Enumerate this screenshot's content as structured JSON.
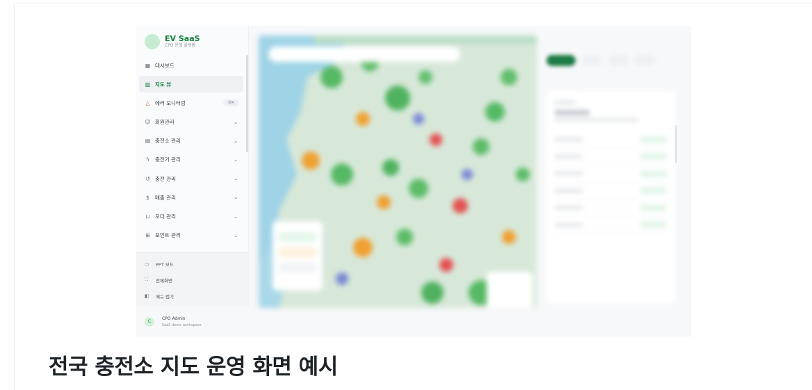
{
  "sidebar": {
    "brand_title": "EV SaaS",
    "brand_subtitle": "CPO 운영 플랫폼",
    "items": [
      {
        "label": "대시보드",
        "icon": "grid-icon"
      },
      {
        "label": "지도 뷰",
        "icon": "map-icon",
        "active": true
      },
      {
        "label": "에러 모니터링",
        "icon": "warning-icon",
        "badge": "알림"
      },
      {
        "label": "회원관리",
        "icon": "users-icon"
      },
      {
        "label": "충전소 관리",
        "icon": "building-icon"
      },
      {
        "label": "충전기 관리",
        "icon": "bolt-icon"
      },
      {
        "label": "충전 관리",
        "icon": "history-icon"
      },
      {
        "label": "매출 관리",
        "icon": "dollar-icon"
      },
      {
        "label": "오더 관리",
        "icon": "cart-icon"
      },
      {
        "label": "포인트 관리",
        "icon": "gift-icon"
      }
    ],
    "bottom": [
      {
        "label": "PPT 모드",
        "icon": "monitor-icon"
      },
      {
        "label": "전체화면",
        "icon": "fullscreen-icon"
      },
      {
        "label": "메뉴 접기",
        "icon": "collapse-icon"
      }
    ],
    "user": {
      "initial": "C",
      "name": "CPO Admin",
      "workspace": "SaaS demo workspace"
    }
  },
  "caption": "전국 충전소 지도 운영 화면 예시",
  "colors": {
    "accent": "#15803d",
    "available": "#4caf50",
    "charging": "#f0a030",
    "error": "#e35050",
    "offline": "#7b86d6"
  }
}
